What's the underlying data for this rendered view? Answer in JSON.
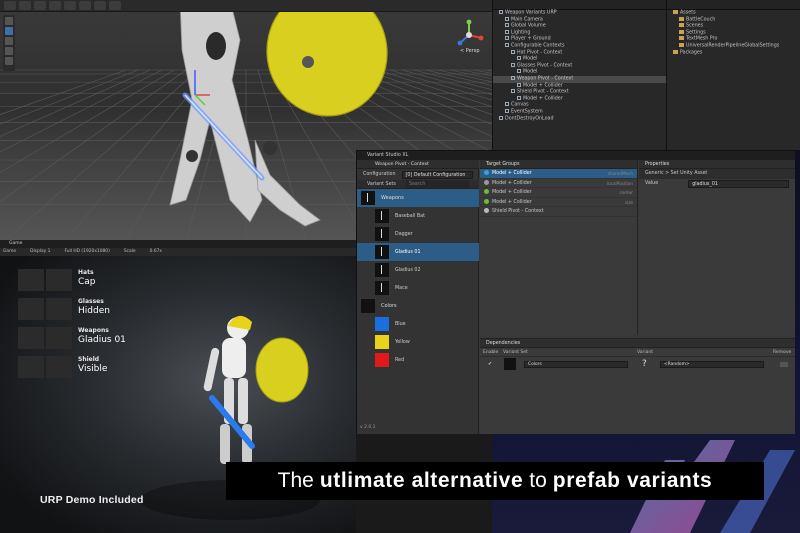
{
  "hierarchy": {
    "rows": [
      {
        "label": "Weapon Variants URP",
        "depth": 0
      },
      {
        "label": "Main Camera",
        "depth": 1
      },
      {
        "label": "Global Volume",
        "depth": 1
      },
      {
        "label": "Lighting",
        "depth": 1
      },
      {
        "label": "Player + Ground",
        "depth": 1
      },
      {
        "label": "Configurable Contexts",
        "depth": 1
      },
      {
        "label": "Hat Pivot - Context",
        "depth": 2
      },
      {
        "label": "Model",
        "depth": 3
      },
      {
        "label": "Glasses Pivot - Context",
        "depth": 2
      },
      {
        "label": "Model",
        "depth": 3
      },
      {
        "label": "Weapon Pivot - Context",
        "depth": 2,
        "selected": true
      },
      {
        "label": "Model + Collider",
        "depth": 3
      },
      {
        "label": "Shield Pivot - Context",
        "depth": 2
      },
      {
        "label": "Model + Collider",
        "depth": 3
      },
      {
        "label": "Canvas",
        "depth": 1
      },
      {
        "label": "EventSystem",
        "depth": 1
      },
      {
        "label": "DontDestroyOnLoad",
        "depth": 0
      }
    ]
  },
  "project": {
    "rows": [
      {
        "label": "Assets",
        "depth": 0
      },
      {
        "label": "BattleCouch",
        "depth": 1
      },
      {
        "label": "Scenes",
        "depth": 1
      },
      {
        "label": "Settings",
        "depth": 1
      },
      {
        "label": "TextMesh Pro",
        "depth": 1
      },
      {
        "label": "UniversalRenderPipelineGlobalSettings",
        "depth": 1
      },
      {
        "label": "Packages",
        "depth": 0
      }
    ]
  },
  "scene": {
    "persp_label": "< Persp"
  },
  "studio": {
    "tab": "Variant Studio XL",
    "breadcrumb": "Weapon Pivot - Context",
    "config_label": "Configuration",
    "config_value": "[0] Default Configuration",
    "variant_sets_label": "Variant Sets",
    "search_placeholder": "Search",
    "groups": [
      {
        "name": "Weapons",
        "variants": [
          "Baseball Bat",
          "Dagger",
          "Gladius 01",
          "Gladius 02",
          "Mace"
        ],
        "selected_index": 2
      },
      {
        "name": "Colors",
        "variants": [
          {
            "label": "Blue",
            "color": "#1a6fe0"
          },
          {
            "label": "Yellow",
            "color": "#e8d21a"
          },
          {
            "label": "Red",
            "color": "#e01a1a"
          }
        ]
      }
    ],
    "target_groups_label": "Target Groups",
    "targets": [
      {
        "label": "Model + Collider",
        "tag": "sharedMesh",
        "color": "#3aa0e0",
        "selected": true
      },
      {
        "label": "Model + Collider",
        "tag": "localPosition",
        "color": "#9a9a9a"
      },
      {
        "label": "Model + Collider",
        "tag": "center",
        "color": "#6cbd3c"
      },
      {
        "label": "Model + Collider",
        "tag": "size",
        "color": "#6cbd3c"
      },
      {
        "label": "Shield Pivot - Context",
        "tag": "",
        "color": "#bbbbbb"
      }
    ],
    "properties_label": "Properties",
    "properties_type": "Generic > Set Unity Asset",
    "value_label": "Value",
    "value": "gladius_01",
    "deps_label": "Dependencies",
    "deps_cols": [
      "Enable",
      "Variant Set",
      "Variant",
      "Remove"
    ],
    "dep_row": {
      "set": "Colors",
      "variant_symbol": "?",
      "variant": "<Random>"
    },
    "version": "v 2.0.1"
  },
  "game": {
    "tab": "Game",
    "toolbar": [
      "Game",
      "Display 1",
      "Full HD (1920x1080)",
      "Scale",
      "0.67x"
    ],
    "items": [
      {
        "category": "Hats",
        "value": "Cap"
      },
      {
        "category": "Glasses",
        "value": "Hidden"
      },
      {
        "category": "Weapons",
        "value": "Gladius 01"
      },
      {
        "category": "Shield",
        "value": "Visible"
      }
    ],
    "footer": "URP Demo Included"
  },
  "banner": {
    "pre": "The",
    "bold1": "utlimate alternative",
    "mid": "to",
    "bold2": "prefab variants"
  },
  "colors": {
    "accent": "#2c5d87",
    "shield": "#d9cf1e"
  }
}
